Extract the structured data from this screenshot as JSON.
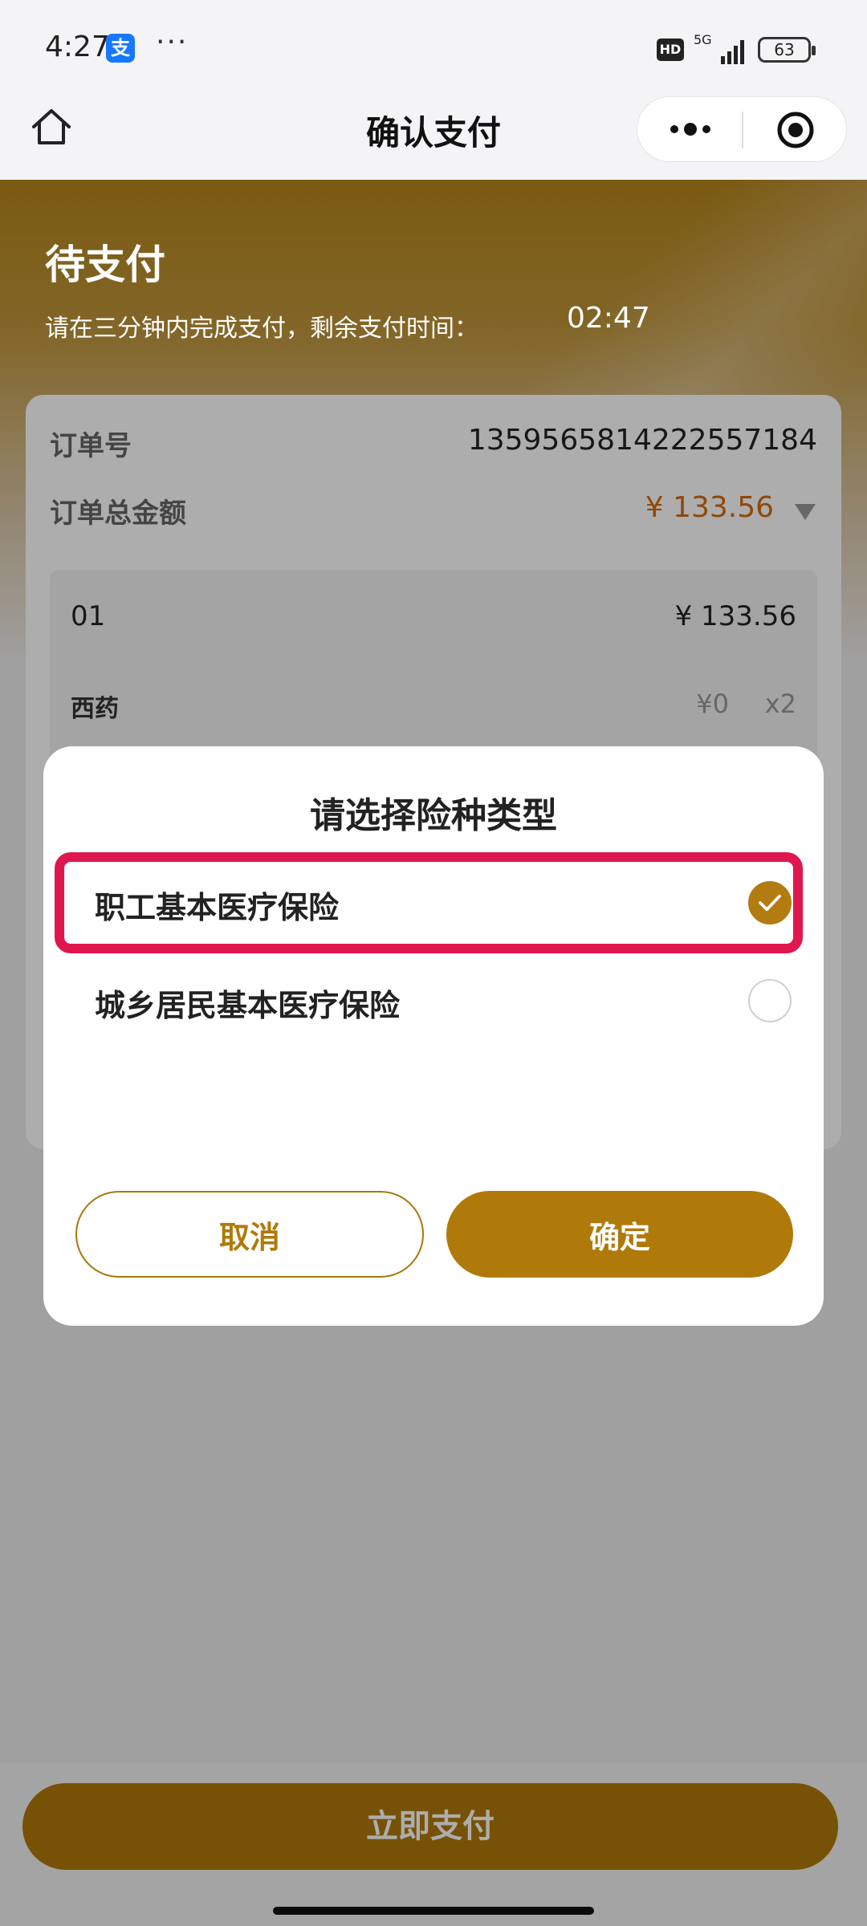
{
  "status_bar": {
    "time": "4:27",
    "app_icon_glyph": "支",
    "more_dots": "···",
    "hd_badge": "HD",
    "network": "5G",
    "battery": "63"
  },
  "nav": {
    "title": "确认支付",
    "home_icon": "home-icon",
    "more_icon": "more-dots-icon",
    "close_icon": "target-icon"
  },
  "header": {
    "status_title": "待支付",
    "hint": "请在三分钟内完成支付，剩余支付时间：",
    "countdown": "02:47"
  },
  "order": {
    "order_no_label": "订单号",
    "order_no": "1359565814222557184",
    "total_label": "订单总金额",
    "total_amount": "¥ 133.56",
    "items": [
      {
        "index": "01",
        "price": "¥ 133.56",
        "sub_name": "西药",
        "sub_price": "¥0",
        "sub_qty": "x2"
      }
    ]
  },
  "modal": {
    "title": "请选择险种类型",
    "options": [
      {
        "label": "职工基本医疗保险",
        "selected": true
      },
      {
        "label": "城乡居民基本医疗保险",
        "selected": false
      }
    ],
    "cancel_label": "取消",
    "confirm_label": "确定"
  },
  "bottom": {
    "pay_label": "立即支付"
  },
  "colors": {
    "accent": "#b07a0a",
    "amount": "#d56a10",
    "highlight": "#e0174f"
  }
}
